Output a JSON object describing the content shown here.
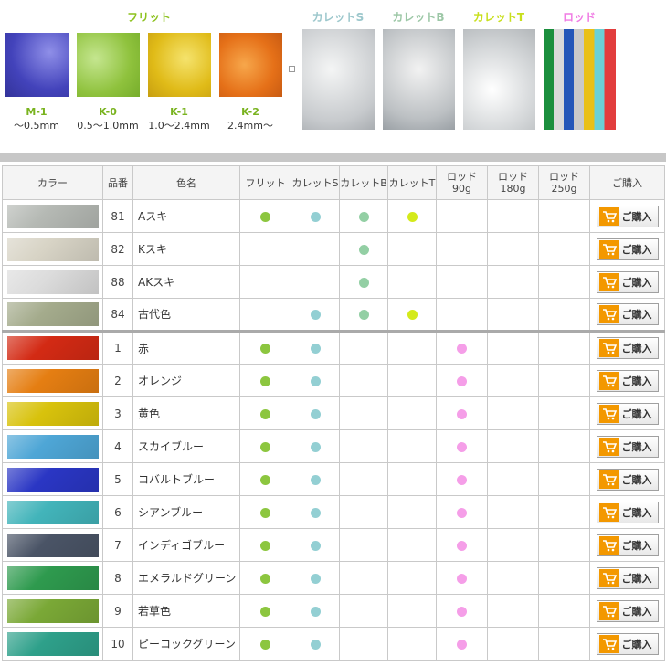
{
  "frit": {
    "title": "フリット",
    "samples": [
      {
        "code": "M-1",
        "size": "〜0.5mm",
        "color": "#5050c8"
      },
      {
        "code": "K-0",
        "size": "0.5〜1.0mm",
        "color": "#a2cf55"
      },
      {
        "code": "K-1",
        "size": "1.0〜2.4mm",
        "color": "#e7c51c"
      },
      {
        "code": "K-2",
        "size": "2.4mm〜",
        "color": "#e77d18"
      }
    ]
  },
  "categories": [
    {
      "title": "カレットS",
      "color": "#9cc7cc"
    },
    {
      "title": "カレットB",
      "color": "#9cc7a6"
    },
    {
      "title": "カレットT",
      "color": "#c8df1c"
    },
    {
      "title": "ロッド",
      "color": "#f07ce4"
    }
  ],
  "table": {
    "headers": [
      "カラー",
      "品番",
      "色名",
      "フリット",
      "カレットS",
      "カレットB",
      "カレットT",
      "ロッド 90g",
      "ロッド 180g",
      "ロッド 250g",
      "ご購入"
    ],
    "buy_label": "ご購入",
    "dot_colors": {
      "frit": "#8cc63f",
      "cs": "#93cfd3",
      "cb": "#93cfa4",
      "ct": "#d4ea1a",
      "rod": "#f59ee8"
    },
    "rows": [
      {
        "num": "81",
        "name": "Aスキ",
        "swatch": "#b5b9b4",
        "marks": [
          "frit",
          "cs",
          "cb",
          "ct",
          "",
          "",
          ""
        ]
      },
      {
        "num": "82",
        "name": "Kスキ",
        "swatch": "#d8d4c6",
        "marks": [
          "",
          "",
          "cb",
          "",
          "",
          "",
          ""
        ]
      },
      {
        "num": "88",
        "name": "AKスキ",
        "swatch": "#dcdcdc",
        "marks": [
          "",
          "",
          "cb",
          "",
          "",
          "",
          ""
        ]
      },
      {
        "num": "84",
        "name": "古代色",
        "swatch": "#a4ab8c",
        "marks": [
          "",
          "cs",
          "cb",
          "ct",
          "",
          "",
          ""
        ]
      },
      {
        "num": "1",
        "name": "赤",
        "swatch": "#d32a14",
        "marks": [
          "frit",
          "cs",
          "",
          "",
          "rod",
          "",
          ""
        ]
      },
      {
        "num": "2",
        "name": "オレンジ",
        "swatch": "#e57e12",
        "marks": [
          "frit",
          "cs",
          "",
          "",
          "rod",
          "",
          ""
        ]
      },
      {
        "num": "3",
        "name": "黄色",
        "swatch": "#d8c20c",
        "marks": [
          "frit",
          "cs",
          "",
          "",
          "rod",
          "",
          ""
        ]
      },
      {
        "num": "4",
        "name": "スカイブルー",
        "swatch": "#4ea6d6",
        "marks": [
          "frit",
          "cs",
          "",
          "",
          "rod",
          "",
          ""
        ]
      },
      {
        "num": "5",
        "name": "コバルトブルー",
        "swatch": "#2a36c4",
        "marks": [
          "frit",
          "cs",
          "",
          "",
          "rod",
          "",
          ""
        ]
      },
      {
        "num": "6",
        "name": "シアンブルー",
        "swatch": "#42b4ba",
        "marks": [
          "frit",
          "cs",
          "",
          "",
          "rod",
          "",
          ""
        ]
      },
      {
        "num": "7",
        "name": "インディゴブルー",
        "swatch": "#4a5466",
        "marks": [
          "frit",
          "cs",
          "",
          "",
          "rod",
          "",
          ""
        ]
      },
      {
        "num": "8",
        "name": "エメラルドグリーン",
        "swatch": "#2e9a4e",
        "marks": [
          "frit",
          "cs",
          "",
          "",
          "rod",
          "",
          ""
        ]
      },
      {
        "num": "9",
        "name": "若草色",
        "swatch": "#7aa836",
        "marks": [
          "frit",
          "cs",
          "",
          "",
          "rod",
          "",
          ""
        ]
      },
      {
        "num": "10",
        "name": "ピーコックグリーン",
        "swatch": "#2ea08a",
        "marks": [
          "frit",
          "cs",
          "",
          "",
          "rod",
          "",
          ""
        ]
      }
    ]
  }
}
